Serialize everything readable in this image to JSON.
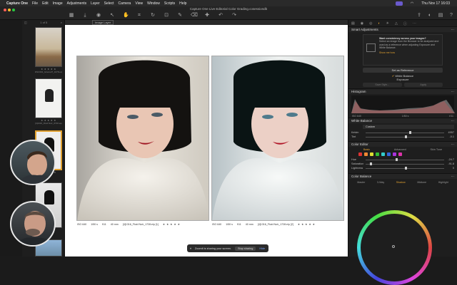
{
  "menubar": {
    "app": "Capture One",
    "items": [
      "File",
      "Edit",
      "Image",
      "Adjustments",
      "Layer",
      "Select",
      "Camera",
      "View",
      "Window",
      "Scripts",
      "Help"
    ],
    "clock": "Thu Nov 17  16:03"
  },
  "window": {
    "title": "Capture One Live Editorial Color Grading.cosessiondb"
  },
  "browser": {
    "count": "1 of 5",
    "thumbs": [
      {
        "name": "DSC601_Grieco27_1678.eip",
        "stars": "★ ★ ★ ★ ★"
      },
      {
        "name": "[4]1316_Fluid Noir_0720.eip",
        "stars": "★ ★ ★ ★ ★"
      },
      {
        "name": "",
        "stars": "★ ★ ★ ★ ★"
      },
      {
        "name": "1728.eip",
        "stars": "★ ★ ★ ★ ★"
      }
    ]
  },
  "viewer": {
    "layer": "Image Layer",
    "left": {
      "iso": "ISO 640",
      "shutter": "1/50 s",
      "aperture": "f/11",
      "focal": "40 mm",
      "name": "[4]1316_Fluid Noir_1728.eip [1]",
      "stars": "★ ★ ★ ★ ★"
    },
    "right": {
      "iso": "ISO 640",
      "shutter": "1/50 s",
      "aperture": "f/11",
      "focal": "40 mm",
      "name": "[4]1316_Fluid Noir_1728.eip [2]",
      "stars": "★ ★ ★ ★ ★"
    }
  },
  "toast": {
    "message": "ZoomIt is sharing your screen.",
    "stop": "Stop sharing",
    "hide": "Hide"
  },
  "tools": {
    "smart_adjustments": {
      "title": "Smart Adjustments",
      "heading": "Want consistency across your images?",
      "body": "Select an image from the Browser to be analyzed and used as a reference when adjusting Exposure and White Balance.",
      "link": "Show me how",
      "set_reference": "Set as Reference",
      "white_balance": "White Balance",
      "exposure": "Exposure",
      "btn_left": "Save Style...",
      "btn_right": "Apply"
    },
    "histogram": {
      "title": "Histogram",
      "iso": "ISO 640",
      "shutter": "1/50 s",
      "aperture": "f/11"
    },
    "white_balance": {
      "title": "White Balance",
      "mode": "Custom",
      "kelvin_label": "Kelvin",
      "kelvin_value": "4957",
      "tint_label": "Tint",
      "tint_value": "-0.1"
    },
    "color_editor": {
      "title": "Color Editor",
      "tabs": [
        "Basic",
        "Advanced",
        "Skin Tone"
      ],
      "swatch_colors": [
        "#d33",
        "#e83",
        "#dd3",
        "#3b3",
        "#3cc",
        "#36d",
        "#a3d",
        "#d3a"
      ],
      "hue_label": "Hue",
      "hue_value": "-24.7",
      "sat_label": "Saturation",
      "sat_value": "-91.8",
      "light_label": "Lightness",
      "light_value": "0"
    },
    "color_balance": {
      "title": "Color Balance",
      "tabs": [
        "Master",
        "3-Way",
        "Shadow",
        "Midtone",
        "Highlight"
      ]
    }
  }
}
